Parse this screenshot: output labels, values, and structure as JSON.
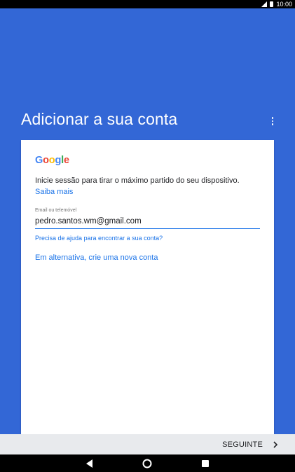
{
  "status_bar": {
    "time": "10:00"
  },
  "header": {
    "title": "Adicionar a sua conta"
  },
  "card": {
    "logo": [
      "G",
      "o",
      "o",
      "g",
      "l",
      "e"
    ],
    "intro": "Inicie sessão para tirar o máximo partido do seu dispositivo.",
    "learn_more": "Saiba mais",
    "email_label": "Email ou telemóvel",
    "email_value": "pedro.santos.wm@gmail.com",
    "help_link": "Precisa de ajuda para encontrar a sua conta?",
    "create_account": "Em alternativa, crie uma nova conta"
  },
  "footer": {
    "next_label": "SEGUINTE"
  },
  "colors": {
    "header_bg": "#3367d6",
    "link": "#1a73e8",
    "footer_bg": "#e8eaed"
  },
  "icons": [
    "signal-icon",
    "battery-icon",
    "overflow-menu-icon",
    "chevron-right-icon",
    "nav-back-icon",
    "nav-home-icon",
    "nav-recent-icon"
  ]
}
